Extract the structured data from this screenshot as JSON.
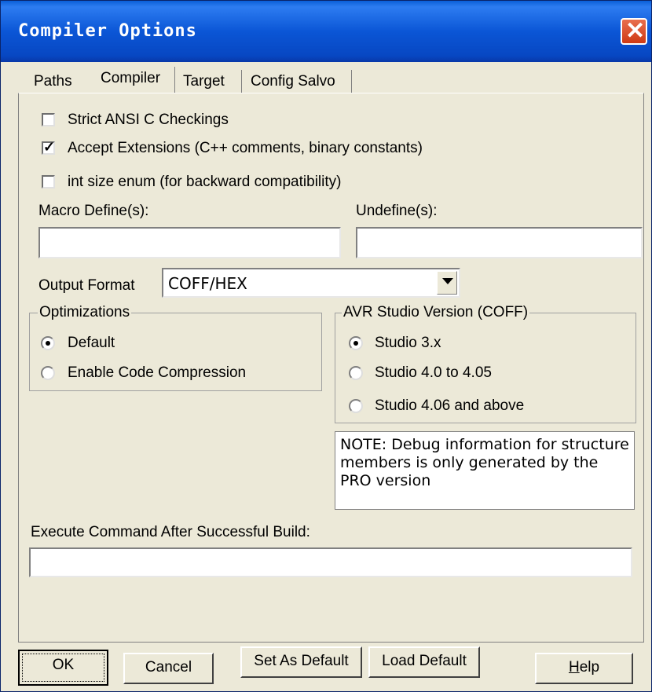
{
  "window": {
    "title": "Compiler Options"
  },
  "tabs": [
    {
      "label": "Paths"
    },
    {
      "label": "Compiler"
    },
    {
      "label": "Target"
    },
    {
      "label": "Config Salvo"
    }
  ],
  "checkboxes": [
    {
      "label": "Strict ANSI C Checkings",
      "checked": false
    },
    {
      "label": "Accept Extensions (C++ comments, binary constants)",
      "checked": true
    },
    {
      "label": "int size enum (for backward compatibility)",
      "checked": false
    }
  ],
  "macro_define": {
    "label": "Macro Define(s):",
    "value": ""
  },
  "undefine": {
    "label": "Undefine(s):",
    "value": ""
  },
  "output_format": {
    "label": "Output Format",
    "value": "COFF/HEX"
  },
  "optimizations": {
    "title": "Optimizations",
    "options": [
      {
        "label": "Default",
        "selected": true
      },
      {
        "label": "Enable Code Compression",
        "selected": false
      }
    ]
  },
  "avr_studio": {
    "title": "AVR Studio Version (COFF)",
    "options": [
      {
        "label": "Studio 3.x",
        "selected": true
      },
      {
        "label": "Studio 4.0 to 4.05",
        "selected": false
      },
      {
        "label": "Studio 4.06 and above",
        "selected": false
      }
    ]
  },
  "note": "NOTE: Debug information for structure members is only generated by the PRO version",
  "execute_command": {
    "label": "Execute Command After Successful Build:",
    "value": ""
  },
  "buttons": {
    "ok": "OK",
    "cancel": "Cancel",
    "set_default": "Set As Default",
    "load_default": "Load Default",
    "help_prefix": "H",
    "help_rest": "elp"
  },
  "icons": {
    "check": "checkmark-icon",
    "close": "close-icon",
    "dropdown": "chevron-down-icon"
  }
}
